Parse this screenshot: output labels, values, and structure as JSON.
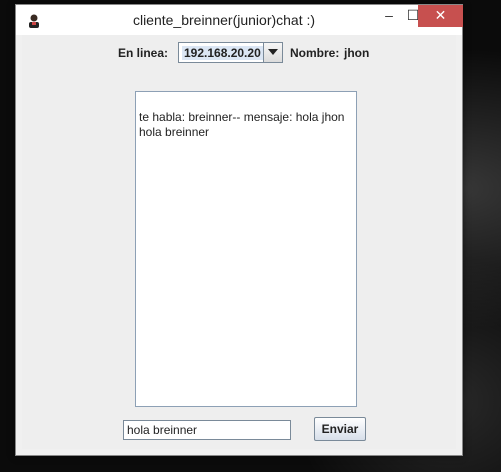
{
  "window": {
    "title": "cliente_breinner(junior)chat :)",
    "controls": {
      "minimize": "–",
      "maximize": "☐",
      "close": "✕"
    }
  },
  "header": {
    "online_label": "En linea:",
    "ip_selected": "192.168.20.20",
    "name_label": "Nombre:",
    "name_value": "jhon"
  },
  "chat": {
    "messages": [
      "te habla: breinner-- mensaje: hola jhon",
      "hola breinner"
    ]
  },
  "composer": {
    "input_value": "hola breinner",
    "send_label": "Enviar"
  },
  "colors": {
    "close_button": "#c7504f",
    "window_bg": "#eeeeee",
    "desktop_bg": "#0b0b0b"
  }
}
